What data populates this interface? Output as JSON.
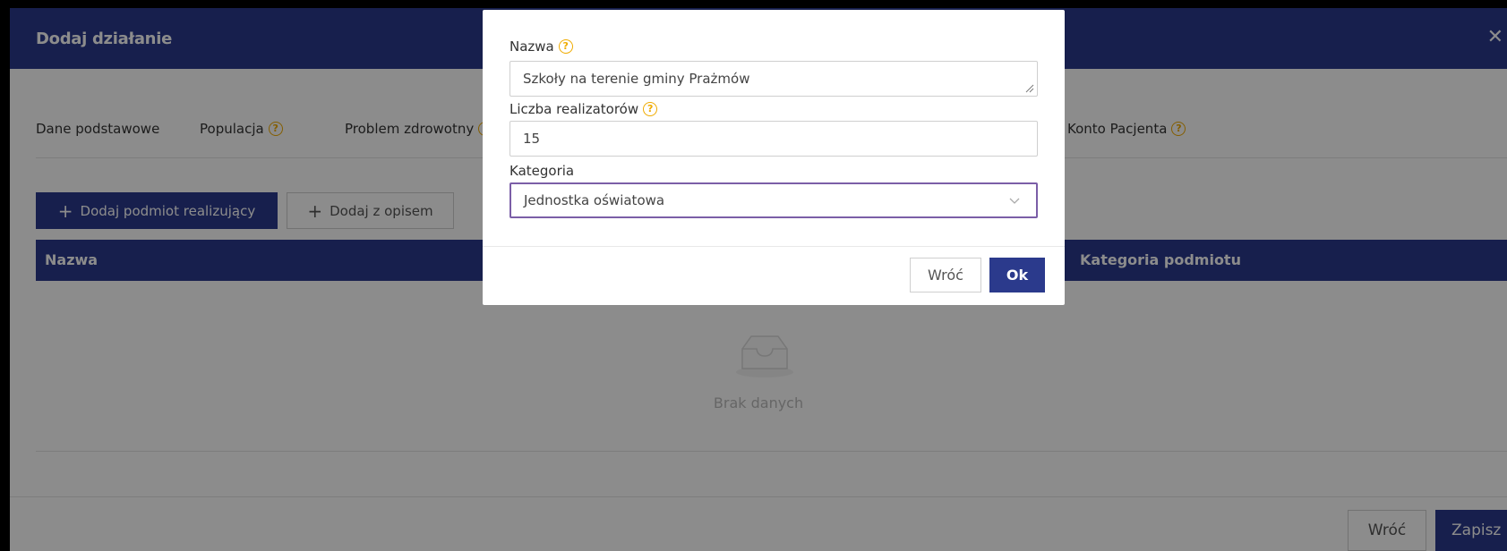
{
  "window": {
    "title": "Dodaj działanie",
    "close_glyph": "✕"
  },
  "tabs": [
    {
      "label": "Dane podstawowe",
      "help": false
    },
    {
      "label": "Populacja",
      "help": true
    },
    {
      "label": "Problem zdrowotny",
      "help": true
    },
    {
      "label": "Konto Pacjenta",
      "help": true
    }
  ],
  "toolbar": {
    "add_entity_label": "Dodaj podmiot realizujący",
    "add_with_description_label": "Dodaj z opisem"
  },
  "table": {
    "columns": [
      "Nazwa",
      "Kategoria podmiotu"
    ],
    "empty_text": "Brak danych"
  },
  "footer": {
    "back_label": "Wróć",
    "save_label": "Zapisz"
  },
  "modal": {
    "name_label": "Nazwa",
    "name_value": "Szkoły na terenie gminy Prażmów",
    "count_label": "Liczba realizatorów",
    "count_value": "15",
    "category_label": "Kategoria",
    "category_value": "Jednostka oświatowa",
    "back_label": "Wróć",
    "ok_label": "Ok"
  },
  "help_glyph": "?",
  "plus_glyph": "+",
  "colors": {
    "primary": "#2b3a8c",
    "help": "#f0ab00",
    "focus": "#7b5ea7"
  }
}
